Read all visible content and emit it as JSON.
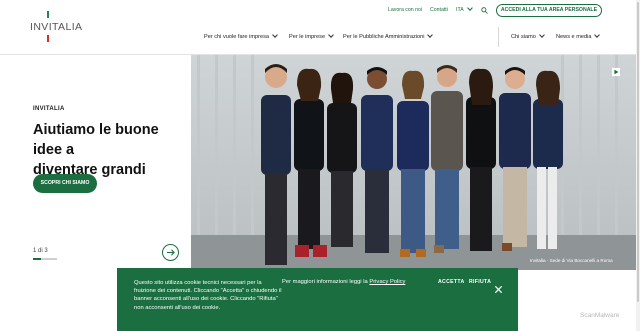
{
  "header": {
    "logo_text": "INVITALIA",
    "top_links": [
      "Lavora con noi",
      "Contatti"
    ],
    "language": "ITA",
    "cta": "ACCEDI ALLA TUA AREA PERSONALE",
    "main_nav": [
      "Per chi vuole fare impresa",
      "Per le imprese",
      "Per le Pubbliche Amministrazioni"
    ],
    "secondary_nav": [
      "Chi siamo",
      "News e media"
    ]
  },
  "hero": {
    "eyebrow": "INVITALIA",
    "headline_line1": "Aiutiamo le buone idee a",
    "headline_line2": "diventare grandi",
    "button": "SCOPRI CHI SIAMO",
    "pager": "1 di 3",
    "pager_progress": 0.33,
    "photo_caption": "Invitalia - Sede di Via Boccanelli a Roma"
  },
  "cookie": {
    "text": "Questo sito utilizza cookie tecnici necessari per la fruizione dei contenuti. Cliccando \"Accetta\" o chiudendo il banner acconsenti all'uso dei cookie. Cliccando \"Rifiuta\" non acconsenti all'uso dei cookie.",
    "more_prefix": "Per maggiori informazioni leggi la",
    "more_link": "Privacy Policy",
    "accept": "ACCETTA",
    "reject": "RIFIUTA"
  },
  "watermark": "ScanMalware",
  "colors": {
    "brand_green": "#1a6e3f",
    "accent_red": "#d4312b"
  }
}
